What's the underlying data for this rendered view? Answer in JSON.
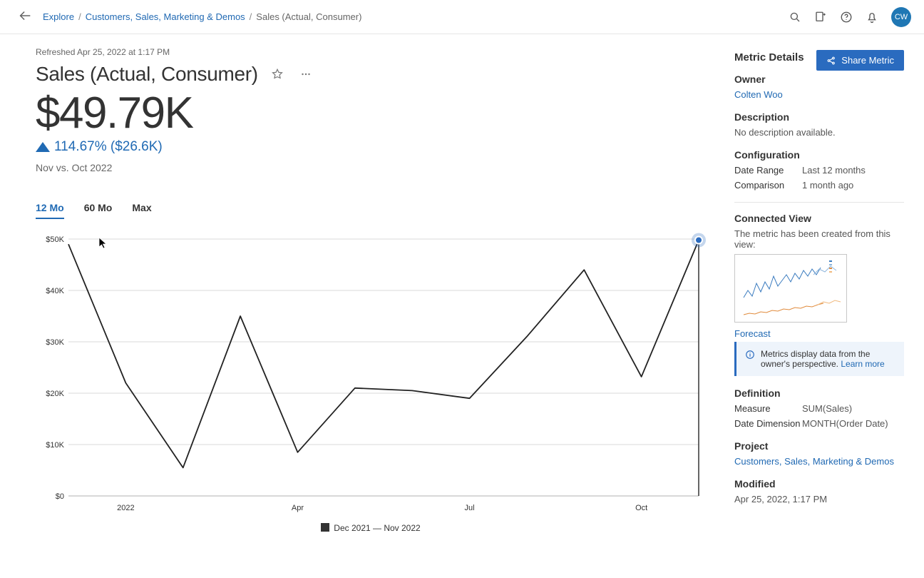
{
  "topbar": {
    "breadcrumbs": {
      "root": "Explore",
      "level1": "Customers, Sales, Marketing & Demos",
      "leaf": "Sales (Actual, Consumer)"
    },
    "avatar": "CW"
  },
  "share_label": "Share Metric",
  "refreshed": "Refreshed Apr 25, 2022 at 1:17 PM",
  "title": "Sales (Actual, Consumer)",
  "metric_value": "$49.79K",
  "change": "114.67% ($26.6K)",
  "comparison": "Nov vs. Oct 2022",
  "range_tabs": {
    "t1": "12 Mo",
    "t2": "60 Mo",
    "t3": "Max"
  },
  "legend": "Dec 2021 — Nov 2022",
  "side": {
    "heading": "Metric Details",
    "owner_h": "Owner",
    "owner": "Colten Woo",
    "description_h": "Description",
    "description": "No description available.",
    "config_h": "Configuration",
    "date_range_k": "Date Range",
    "date_range_v": "Last 12 months",
    "comparison_k": "Comparison",
    "comparison_v": "1 month ago",
    "connected_h": "Connected View",
    "connected_desc": "The metric has been created from this view:",
    "connected_name": "Forecast",
    "info_text": "Metrics display data from the owner's perspective. ",
    "learn_more": "Learn more",
    "definition_h": "Definition",
    "measure_k": "Measure",
    "measure_v": "SUM(Sales)",
    "dimension_k": "Date Dimension",
    "dimension_v": "MONTH(Order Date)",
    "project_h": "Project",
    "project": "Customers, Sales, Marketing & Demos",
    "modified_h": "Modified",
    "modified": "Apr 25, 2022, 1:17 PM"
  },
  "chart_data": {
    "type": "line",
    "title": "",
    "xlabel": "",
    "ylabel": "",
    "ylim": [
      0,
      50000
    ],
    "y_ticks": [
      "$0",
      "$10K",
      "$20K",
      "$30K",
      "$40K",
      "$50K"
    ],
    "x_ticks": [
      "2022",
      "Apr",
      "Jul",
      "Oct"
    ],
    "categories": [
      "Dec 2021",
      "Jan 2022",
      "Feb 2022",
      "Mar 2022",
      "Apr 2022",
      "May 2022",
      "Jun 2022",
      "Jul 2022",
      "Aug 2022",
      "Sep 2022",
      "Oct 2022",
      "Nov 2022"
    ],
    "values": [
      49000,
      22000,
      5500,
      35000,
      8500,
      21000,
      20500,
      19000,
      31000,
      44000,
      23200,
      49790
    ],
    "highlight_index": 11,
    "series_name": "Dec 2021 — Nov 2022"
  }
}
